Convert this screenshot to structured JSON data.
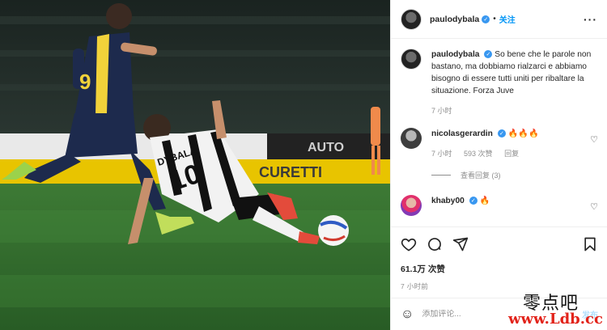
{
  "post": {
    "username": "paulodybala",
    "verified_icon": "verified-badge-icon",
    "follow_label": "关注",
    "more_icon": "more-options-icon",
    "photo": {
      "player_front_name": "DYBALA",
      "player_front_number": "10",
      "player_back_number": "9",
      "board_text_left": "AUTO",
      "board_text_right": "CURETTI"
    }
  },
  "caption": {
    "username": "paulodybala",
    "text": "So bene che le parole non bastano, ma dobbiamo rialzarci e abbiamo bisogno di essere tutti uniti per ribaltare la situazione. Forza Juve",
    "time": "7 小时"
  },
  "comments": [
    {
      "username": "nicolasgerardin",
      "text": "🔥🔥🔥",
      "time": "7 小时",
      "likes": "593 次赞",
      "reply_label": "回复",
      "view_replies": "查看回复 (3)"
    },
    {
      "username": "khaby00",
      "text": "🔥"
    }
  ],
  "actions": {
    "like_icon": "heart-icon",
    "comment_icon": "comment-icon",
    "share_icon": "share-icon",
    "save_icon": "bookmark-icon",
    "likes": "61.1万 次赞",
    "time": "7 小时前"
  },
  "add_comment": {
    "emoji_icon": "emoji-icon",
    "placeholder": "添加评论...",
    "post_label": "发布"
  },
  "watermark": {
    "line1": "零点吧",
    "line2": "www.Ldb.cc"
  },
  "colors": {
    "accent": "#0095f6",
    "verified": "#3897f0",
    "muted": "#8e8e8e",
    "pitch": "#2f6d2c",
    "juve_white": "#f2f2f2",
    "verona_navy": "#1d2a4d",
    "verona_yellow": "#f2d23a",
    "watermark_red": "#e2231a"
  }
}
